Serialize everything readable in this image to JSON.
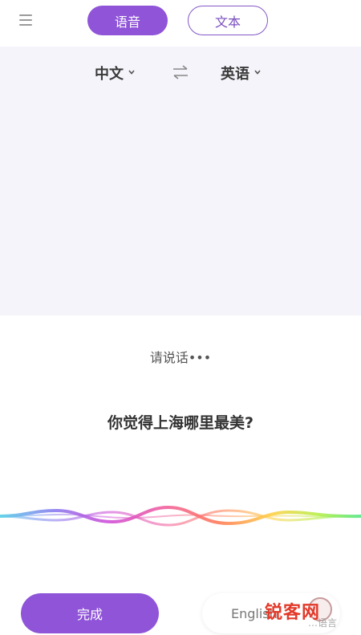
{
  "topbar": {
    "menu_icon": "hamburger-menu-icon",
    "tabs": [
      {
        "label": "语音",
        "active": true
      },
      {
        "label": "文本",
        "active": false
      }
    ]
  },
  "language_bar": {
    "source": "中文",
    "target": "英语",
    "swap_icon": "swap-arrows-icon"
  },
  "listening": {
    "prompt": "请说话•••",
    "recognized_text": "你觉得上海哪里最美?"
  },
  "bottom": {
    "done_label": "完成",
    "english_label": "English"
  },
  "watermark": {
    "text": "锐客网",
    "sub": "…语言"
  },
  "colors": {
    "accent": "#8f54d8",
    "panel_bg": "#f5f4fa"
  }
}
